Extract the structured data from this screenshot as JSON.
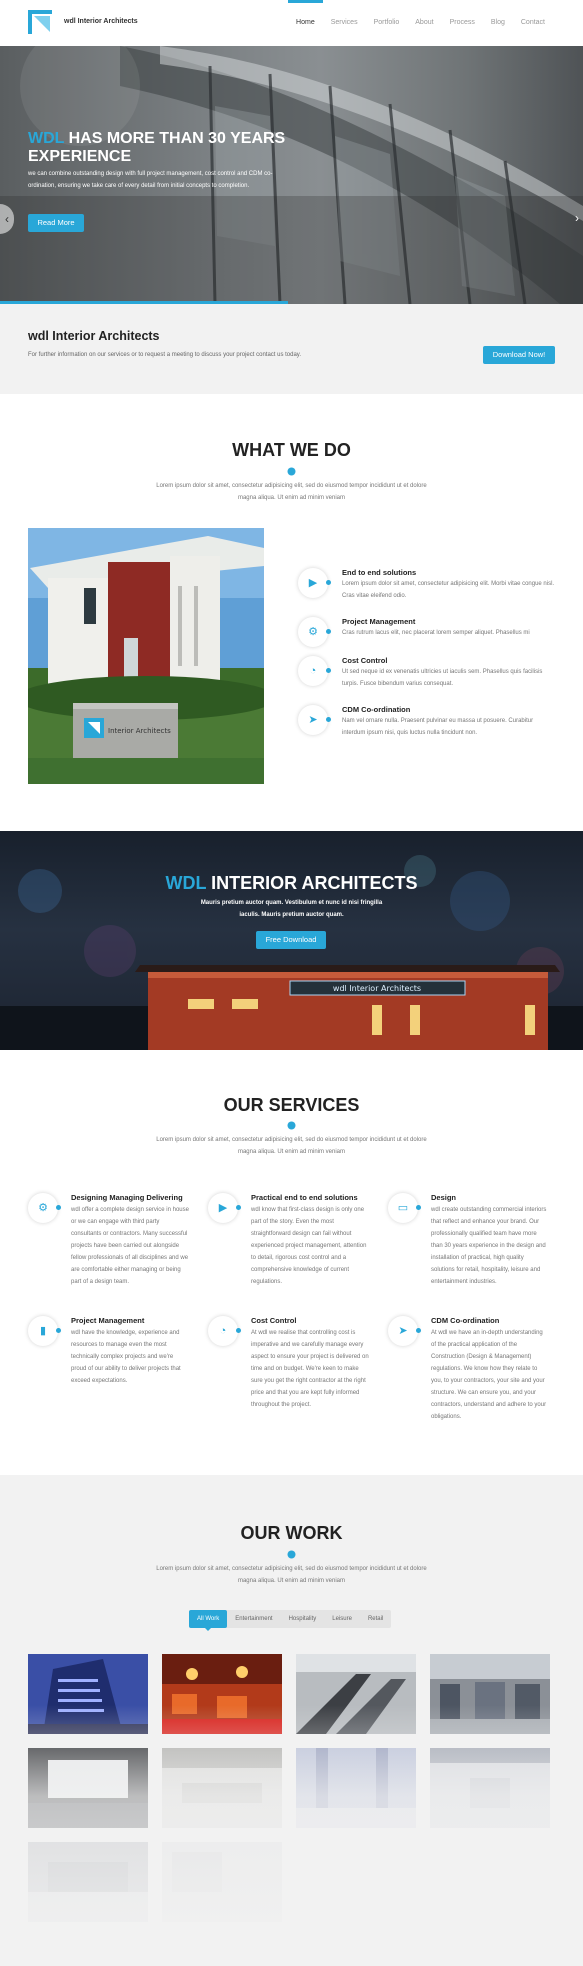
{
  "header": {
    "logo_text": "wdl Interior Architects",
    "nav": [
      "Home",
      "Services",
      "Portfolio",
      "About",
      "Process",
      "Blog",
      "Contact"
    ],
    "active_nav": "Home"
  },
  "hero": {
    "title_accent": "WDL",
    "title_rest": " HAS MORE THAN 30 YEARS EXPERIENCE",
    "text": "we can combine outstanding design with full project management, cost control and CDM co-ordination, ensuring we take care of every detail from initial concepts to completion.",
    "button": "Read More",
    "prev_icon": "‹",
    "next_icon": "›"
  },
  "cta": {
    "title": "wdl Interior Architects",
    "text": "For further information on our services or to request a meeting to discuss your project contact us today.",
    "button": "Download Now!"
  },
  "what_we_do": {
    "title": "WHAT WE DO",
    "subtitle": "Lorem ipsum dolor sit amet, consectetur adipisicing elit, sed do eiusmod tempor incididunt ut et dolore magna aliqua. Ut enim ad minim veniam",
    "image_sign_text": "Interior Architects",
    "features": [
      {
        "icon": "play-icon",
        "glyph": "▶",
        "title": "End to end solutions",
        "text": "Lorem ipsum dolor sit amet, consectetur adipisicing elit. Morbi vitae congue nisl. Cras vitae eleifend odio."
      },
      {
        "icon": "cogs-icon",
        "glyph": "⚙",
        "title": "Project Management",
        "text": "Cras rutrum lacus elit, nec placerat lorem semper aliquet. Phasellus mi"
      },
      {
        "icon": "pie-chart-icon",
        "glyph": "◔",
        "title": "Cost Control",
        "text": "Ut sed neque id ex venenatis ultricies ut iaculis sem. Phasellus quis facilisis turpis. Fusce bibendum varius consequat."
      },
      {
        "icon": "navigation-icon",
        "glyph": "➤",
        "title": "CDM Co-ordination",
        "text": "Nam vel ornare nulla. Praesent pulvinar eu massa ut posuere. Curabitur interdum ipsum nisi, quis luctus nulla tincidunt non."
      }
    ]
  },
  "banner": {
    "title_accent": "WDL",
    "title_rest": " INTERIOR ARCHITECTS",
    "text": "Mauris pretium auctor quam. Vestibulum et nunc id nisi fringilla iaculis. Mauris pretium auctor quam.",
    "button": "Free Download",
    "building_sign": "wdl Interior Architects"
  },
  "services": {
    "title": "OUR SERVICES",
    "subtitle": "Lorem ipsum dolor sit amet, consectetur adipisicing elit, sed do eiusmod tempor incididunt ut et dolore magna aliqua. Ut enim ad minim veniam",
    "items": [
      {
        "icon": "cogs-icon",
        "glyph": "⚙",
        "title": "Designing Managing Delivering",
        "text": "wdl offer a complete design service in house or we can engage with third party consultants or contractors. Many successful projects have been carried out alongside fellow professionals of all disciplines and we are comfortable either managing or being part of a design team."
      },
      {
        "icon": "play-icon",
        "glyph": "▶",
        "title": "Practical end to end solutions",
        "text": "wdl know that first-class design is only one part of the story. Even the most straightforward design can fail without experienced project management, attention to detail, rigorous cost control and a comprehensive knowledge of current regulations."
      },
      {
        "icon": "monitor-icon",
        "glyph": "▭",
        "title": "Design",
        "text": "wdl create outstanding commercial interiors that reflect and enhance your brand. Our professionally qualified team have more than 30 years experience in the design and installation of practical, high quality solutions for retail, hospitality, leisure and entertainment industries."
      },
      {
        "icon": "bar-chart-icon",
        "glyph": "▮",
        "title": "Project Management",
        "text": "wdl have the knowledge, experience and resources to manage even the most technically complex projects and we're proud of our ability to deliver projects that exceed expectations."
      },
      {
        "icon": "pie-chart-icon",
        "glyph": "◔",
        "title": "Cost Control",
        "text": "At wdl we realise that controlling cost is imperative and we carefully manage every aspect to ensure your project is delivered on time and on budget. We're keen to make sure you get the right contractor at the right price and that you are kept fully informed throughout the project."
      },
      {
        "icon": "navigation-icon",
        "glyph": "➤",
        "title": "CDM Co-ordination",
        "text": "At wdl we have an in-depth understanding of the practical application of the Construction (Design & Management) regulations. We know how they relate to you, to your contractors, your site and your structure. We can ensure you, and your contractors, understand and adhere to your obligations."
      }
    ]
  },
  "work": {
    "title": "OUR WORK",
    "subtitle": "Lorem ipsum dolor sit amet, consectetur adipisicing elit, sed do eiusmod tempor incididunt ut et dolore magna aliqua. Ut enim ad minim veniam",
    "filters": [
      "All Work",
      "Entertainment",
      "Hospitality",
      "Leisure",
      "Retail"
    ],
    "active_filter": "All Work"
  },
  "colors": {
    "accent": "#29a7d8",
    "dark_text": "#222222",
    "band": "#f2f2f2"
  }
}
